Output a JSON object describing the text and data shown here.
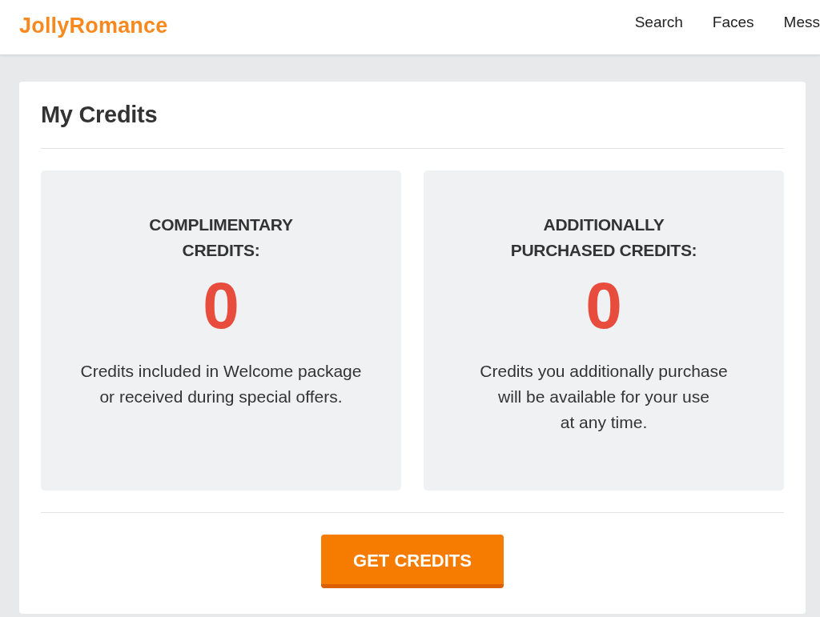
{
  "header": {
    "logo": "JollyRomance",
    "nav": [
      {
        "label": "Search"
      },
      {
        "label": "Faces"
      },
      {
        "label": "Mess"
      }
    ]
  },
  "page": {
    "title": "My Credits",
    "panels": [
      {
        "heading": "COMPLIMENTARY\nCREDITS:",
        "amount": "0",
        "description": "Credits included in Welcome package\nor received during special offers."
      },
      {
        "heading": "ADDITIONALLY\nPURCHASED CREDITS:",
        "amount": "0",
        "description": "Credits you additionally purchase\nwill be available for your use\nat any time."
      }
    ],
    "button": "GET CREDITS"
  }
}
